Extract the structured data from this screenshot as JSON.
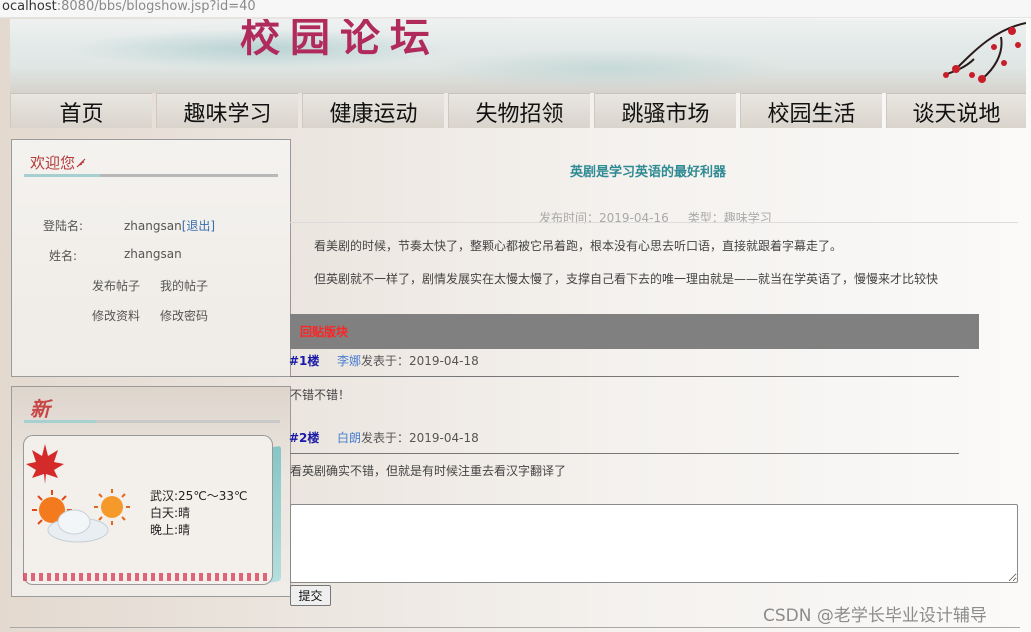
{
  "browser": {
    "url_prefix": "ocalhost",
    "url_rest": ":8080/bbs/blogshow.jsp?id=40"
  },
  "banner": {
    "site_title": "校园论坛"
  },
  "nav": {
    "items": [
      "首页",
      "趣味学习",
      "健康运动",
      "失物招领",
      "跳骚市场",
      "校园生活",
      "谈天说地"
    ]
  },
  "welcome": {
    "title": "欢迎您",
    "login_label": "登陆名:",
    "login_value": "zhangsan",
    "logout": "[退出]",
    "name_label": "姓名:",
    "name_value": "zhangsan",
    "post_link": "发布帖子",
    "my_posts_link": "我的帖子",
    "edit_profile_link": "修改资料",
    "change_password_link": "修改密码"
  },
  "news": {
    "title": "新",
    "city": "武汉:25℃～33℃",
    "day": "白天:晴",
    "night": "晚上:晴"
  },
  "post": {
    "title": "英剧是学习英语的最好利器",
    "meta": "发布时间：2019-04-16     类型：趣味学习",
    "paragraph1": "看美剧的时候，节奏太快了，整颗心都被它吊着跑，根本没有心思去听口语，直接就跟着字幕走了。",
    "paragraph2": "但英剧就不一样了，剧情发展实在太慢太慢了，支撑自己看下去的唯一理由就是——就当在学英语了，慢慢来才比较快"
  },
  "replies": {
    "header": "回贴版块",
    "items": [
      {
        "floor": "#1楼",
        "author": "李娜",
        "posted": "发表于：2019-04-18",
        "text": "不错不错！"
      },
      {
        "floor": "#2楼",
        "author": "白朗",
        "posted": "发表于：2019-04-18",
        "text": "看英剧确实不错，但就是有时候注重去看汉字翻译了"
      }
    ]
  },
  "form": {
    "submit_label": "提交",
    "reply_value": ""
  },
  "watermark": "CSDN @老学长毕业设计辅导"
}
